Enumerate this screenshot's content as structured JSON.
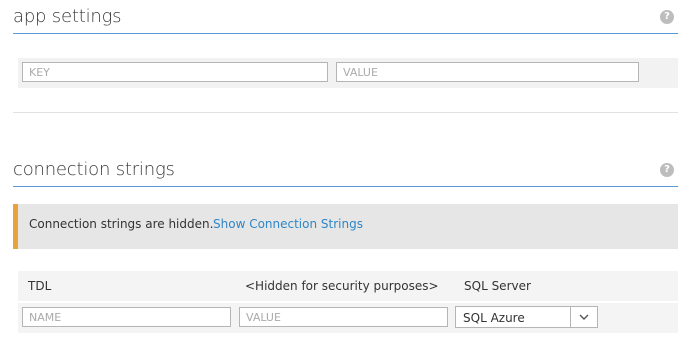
{
  "app_settings": {
    "title": "app settings",
    "help_glyph": "?",
    "key_placeholder": "KEY",
    "value_placeholder": "VALUE"
  },
  "connection_strings": {
    "title": "connection strings",
    "help_glyph": "?",
    "notice_text": "Connection strings are hidden.",
    "notice_link": "Show Connection Strings",
    "existing": {
      "name": "TDL",
      "value": "<Hidden for security purposes>",
      "type": "SQL Server"
    },
    "new_row": {
      "name_placeholder": "NAME",
      "value_placeholder": "VALUE",
      "type_selected": "SQL Azure"
    }
  },
  "colors": {
    "accent": "#5b9bd5",
    "link": "#2f86c6",
    "warning_bar": "#e8a33d"
  }
}
